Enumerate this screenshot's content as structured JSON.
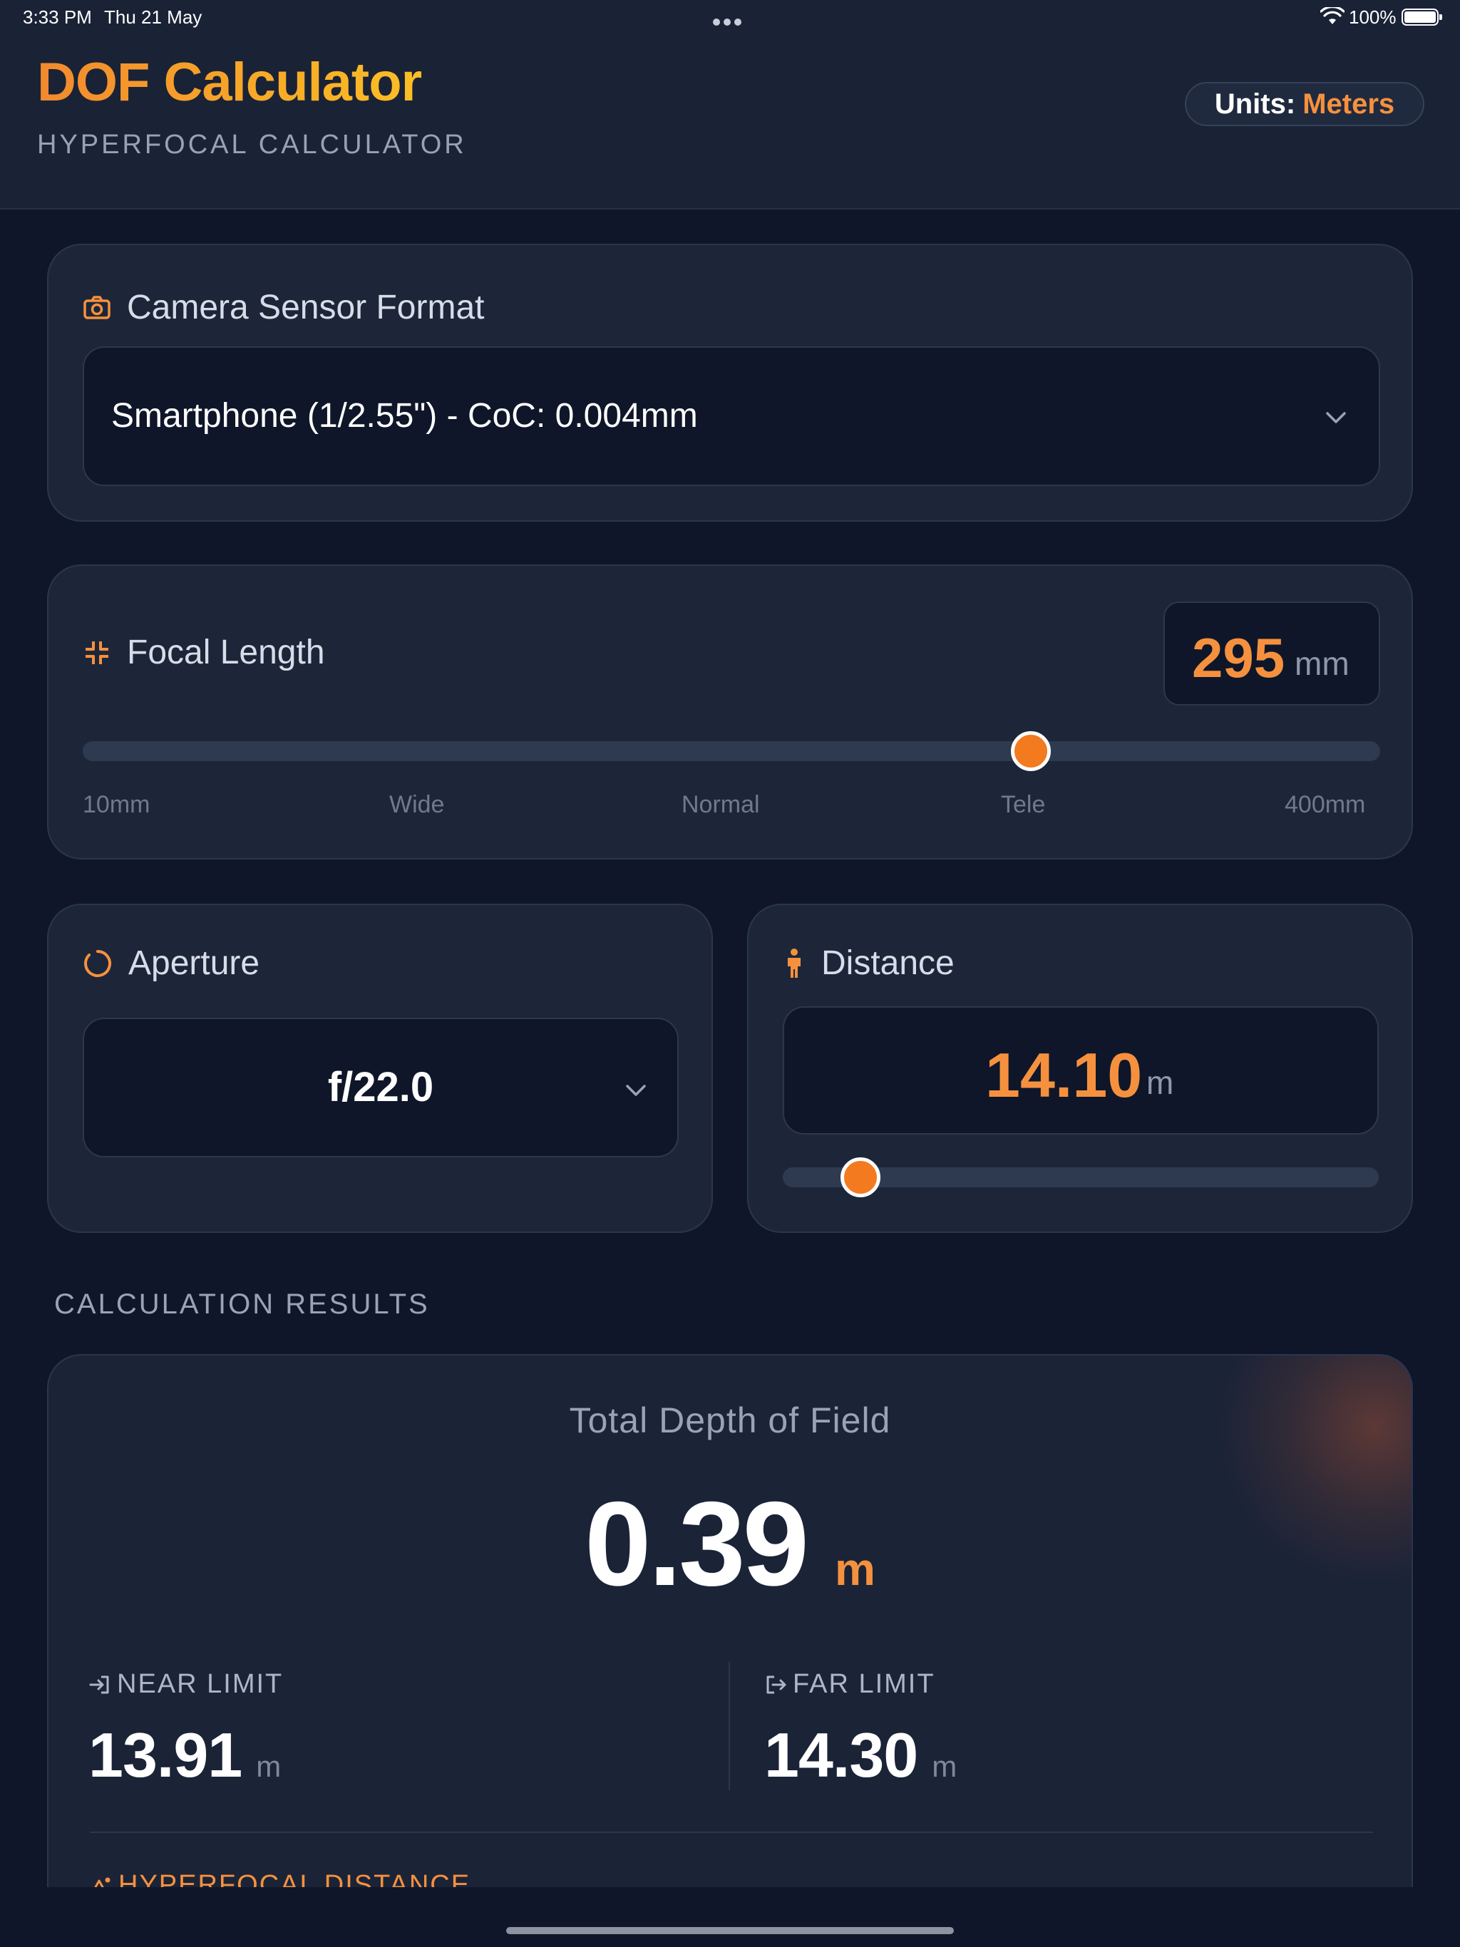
{
  "status_bar": {
    "time": "3:33 PM",
    "date": "Thu 21 May",
    "battery_percent": "100%"
  },
  "header": {
    "title": "DOF Calculator",
    "subtitle": "HYPERFOCAL CALCULATOR",
    "units_label": "Units:",
    "units_value": "Meters"
  },
  "sensor": {
    "label": "Camera Sensor Format",
    "icon": "camera-icon",
    "selected": "Smartphone (1/2.55\") - CoC: 0.004mm"
  },
  "focal_length": {
    "label": "Focal Length",
    "icon": "focus-frame-icon",
    "value": "295",
    "unit": "mm",
    "slider_min": 10,
    "slider_max": 400,
    "slider_value": 295,
    "ticks": [
      "10mm",
      "Wide",
      "Normal",
      "Tele",
      "400mm"
    ]
  },
  "aperture": {
    "label": "Aperture",
    "icon": "aperture-ring-icon",
    "selected": "f/22.0"
  },
  "distance": {
    "label": "Distance",
    "icon": "person-icon",
    "value": "14.10",
    "unit": "m",
    "slider_fraction": 0.13
  },
  "results": {
    "section_title": "CALCULATION RESULTS",
    "total_label": "Total Depth of Field",
    "total_value": "0.39",
    "total_unit": "m",
    "near_label": "NEAR LIMIT",
    "near_value": "13.91",
    "near_unit": "m",
    "far_label": "FAR LIMIT",
    "far_value": "14.30",
    "far_unit": "m",
    "hyperfocal_label": "HYPERFOCAL DISTANCE"
  },
  "colors": {
    "accent": "#f5913e",
    "background": "#0f1629",
    "card": "#1d2639"
  }
}
